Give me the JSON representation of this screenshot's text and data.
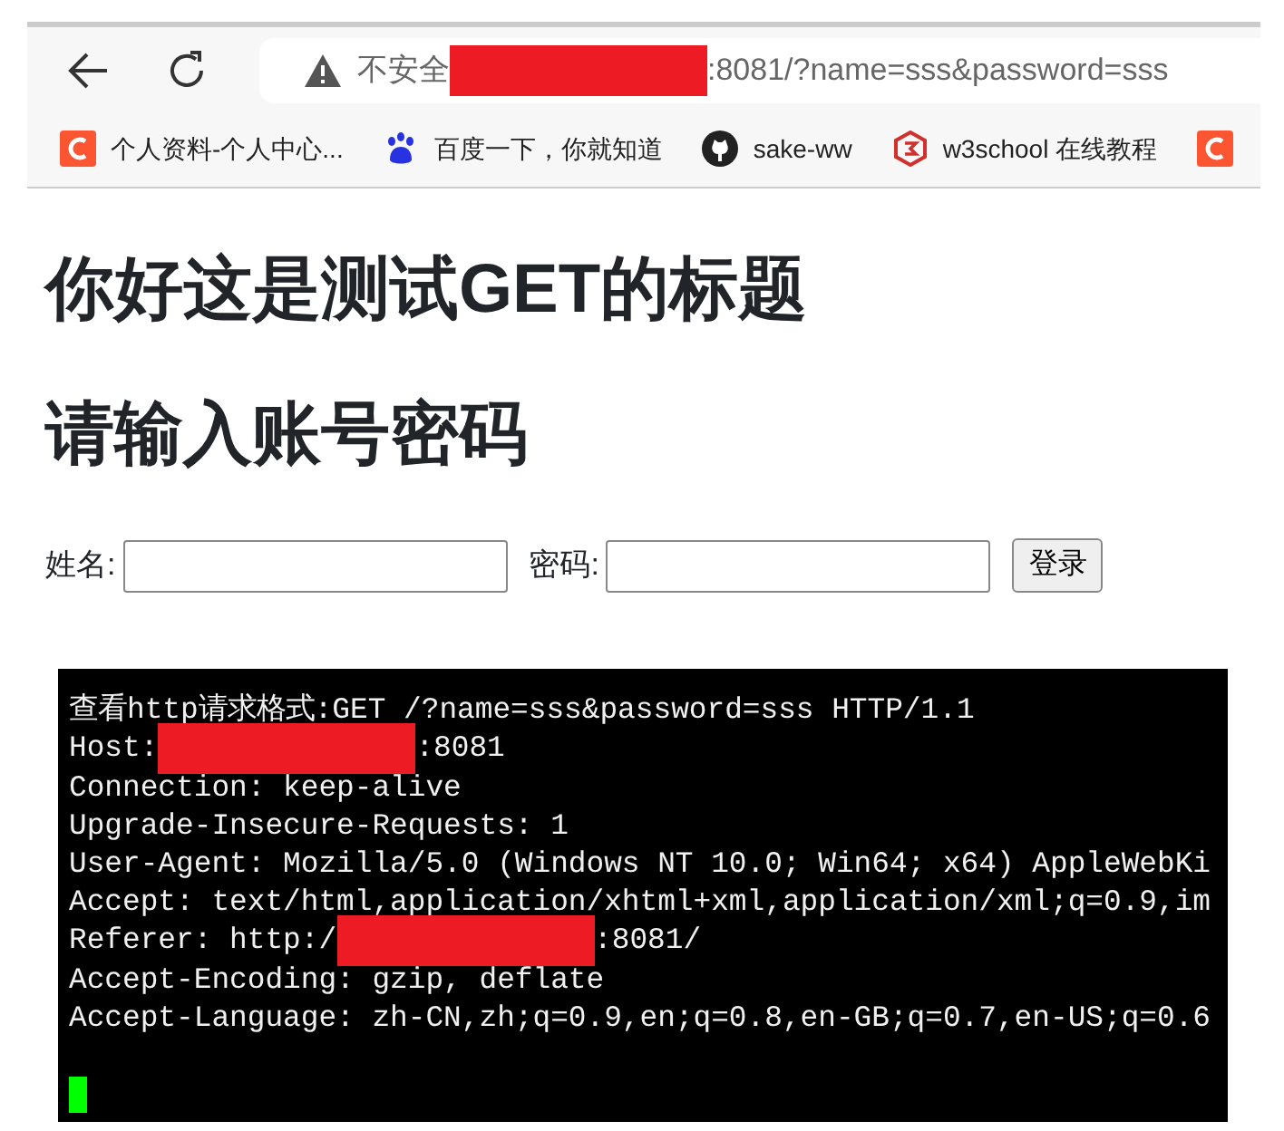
{
  "browser": {
    "address": {
      "security_label": "不安全",
      "url_rest": ":8081/?name=sss&password=sss"
    },
    "bookmarks": [
      {
        "label": "个人资料-个人中心..."
      },
      {
        "label": "百度一下，你就知道"
      },
      {
        "label": "sake-ww"
      },
      {
        "label": "w3school 在线教程"
      }
    ]
  },
  "page": {
    "headings": [
      "你好这是测试GET的标题",
      "请输入账号密码"
    ],
    "form": {
      "name_label": "姓名:",
      "password_label": "密码:",
      "submit": "登录"
    }
  },
  "terminal": {
    "lines": [
      {
        "parts": [
          "查看http请求格式:GET /?name=sss&password=sss HTTP/1.1"
        ]
      },
      {
        "parts": [
          "Host:",
          ":8081"
        ]
      },
      {
        "parts": [
          "Connection: keep-alive"
        ]
      },
      {
        "parts": [
          "Upgrade-Insecure-Requests: 1"
        ]
      },
      {
        "parts": [
          "User-Agent: Mozilla/5.0 (Windows NT 10.0; Win64; x64) AppleWebKi"
        ]
      },
      {
        "parts": [
          "Accept: text/html,application/xhtml+xml,application/xml;q=0.9,im"
        ]
      },
      {
        "parts": [
          "Referer: http:/",
          ":8081/"
        ]
      },
      {
        "parts": [
          "Accept-Encoding: gzip, deflate"
        ]
      },
      {
        "parts": [
          "Accept-Language: zh-CN,zh;q=0.9,en;q=0.8,en-GB;q=0.7,en-US;q=0.6"
        ]
      }
    ],
    "cursor": true
  }
}
